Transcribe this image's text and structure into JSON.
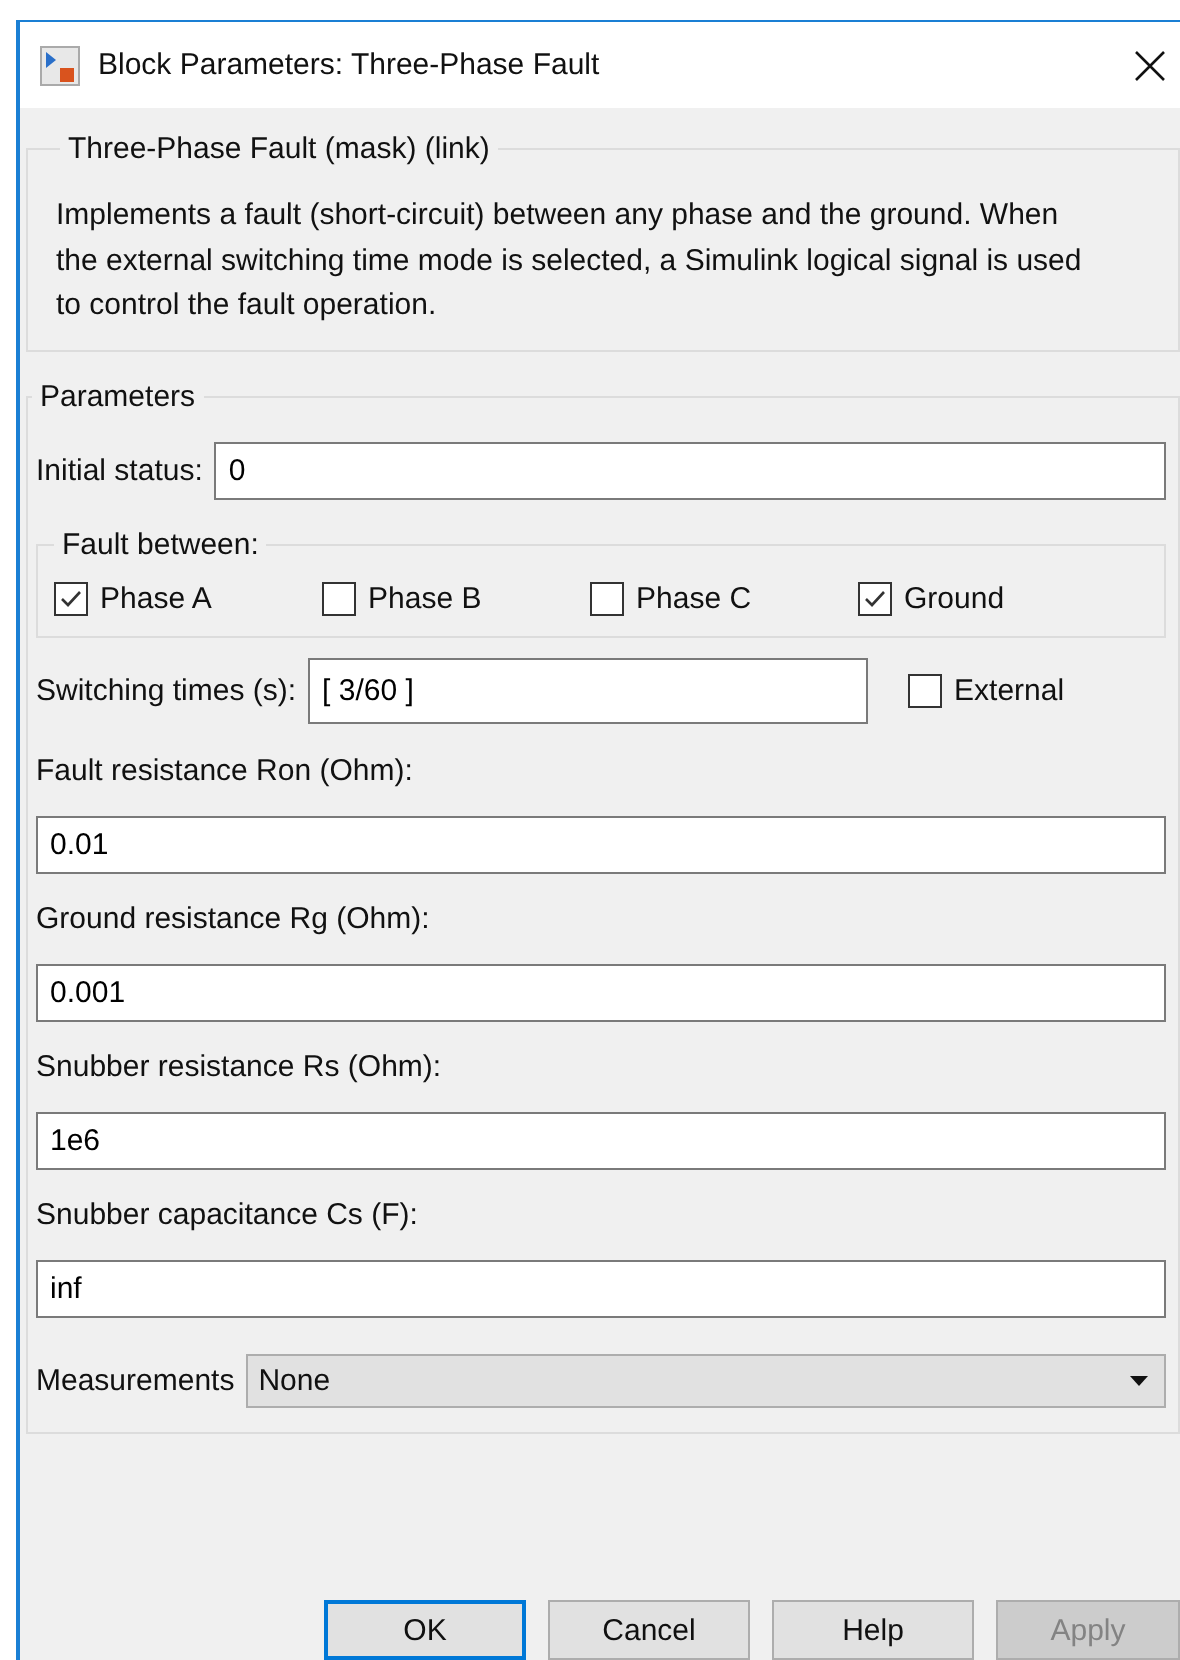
{
  "window": {
    "title": "Block Parameters: Three-Phase Fault"
  },
  "mask_group": {
    "title": "Three-Phase Fault (mask) (link)",
    "description": "Implements a fault (short-circuit) between any phase and the ground. When the external switching time mode is selected, a Simulink logical signal is used to control the fault operation."
  },
  "parameters": {
    "title": "Parameters",
    "initial_status": {
      "label": "Initial status:",
      "value": "0"
    },
    "fault_between": {
      "title": "Fault between:",
      "options": [
        {
          "label": "Phase A",
          "checked": true
        },
        {
          "label": "Phase B",
          "checked": false
        },
        {
          "label": "Phase C",
          "checked": false
        },
        {
          "label": "Ground",
          "checked": true
        }
      ]
    },
    "switching_times": {
      "label": "Switching times (s):",
      "value": "[ 3/60 ]",
      "external": {
        "label": "External",
        "checked": false
      }
    },
    "fields": [
      {
        "label": "Fault resistance Ron (Ohm):",
        "value": "0.01"
      },
      {
        "label": "Ground resistance Rg (Ohm):",
        "value": "0.001"
      },
      {
        "label": "Snubber resistance Rs (Ohm):",
        "value": "1e6"
      },
      {
        "label": "Snubber capacitance Cs (F):",
        "value": "inf"
      }
    ],
    "measurements": {
      "label": "Measurements",
      "value": "None"
    }
  },
  "buttons": [
    {
      "label": "OK",
      "default": true,
      "disabled": false
    },
    {
      "label": "Cancel",
      "default": false,
      "disabled": false
    },
    {
      "label": "Help",
      "default": false,
      "disabled": false
    },
    {
      "label": "Apply",
      "default": false,
      "disabled": true
    }
  ]
}
